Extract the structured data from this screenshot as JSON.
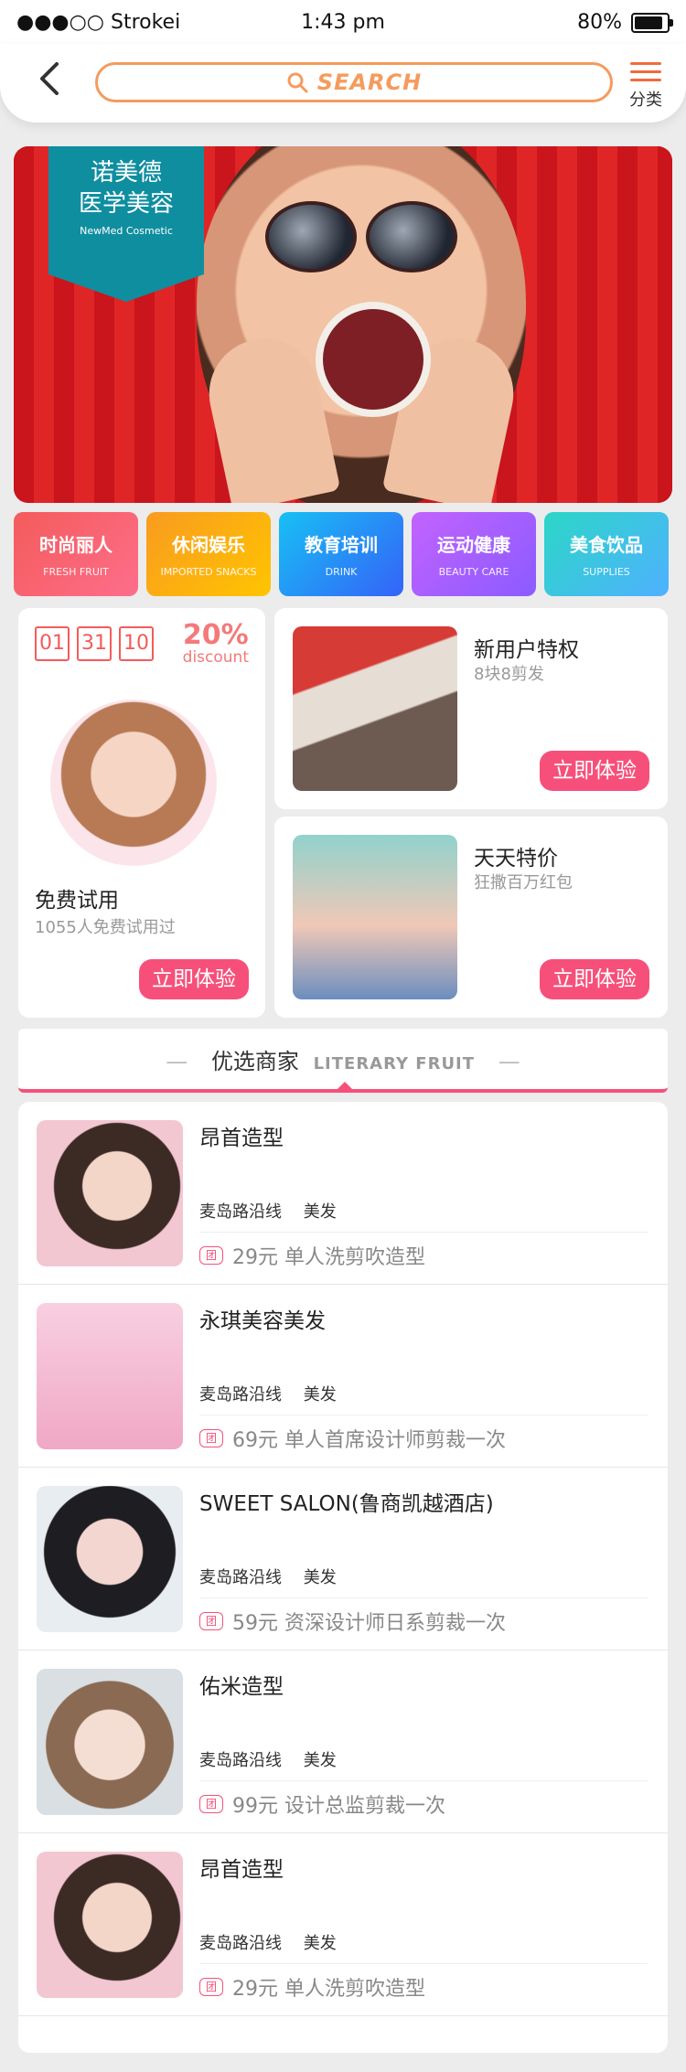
{
  "status": {
    "carrier": "●●●○○ Strokei",
    "time": "1:43 pm",
    "battery": "80%"
  },
  "header": {
    "search_placeholder": "SEARCH",
    "category_label": "分类"
  },
  "banner": {
    "badge_cn": "诺美德\n医学美容",
    "badge_en": "NewMed Cosmetic"
  },
  "categories": [
    {
      "title": "时尚丽人",
      "sub": "FRESH  FRUIT",
      "color_from": "#f45b5b",
      "color_to": "#fd6e8b"
    },
    {
      "title": "休闲娱乐",
      "sub": "IMPORTED SNACKS",
      "color_from": "#f99b20",
      "color_to": "#ffc400"
    },
    {
      "title": "教育培训",
      "sub": "DRINK",
      "color_from": "#17c0f4",
      "color_to": "#3562f8"
    },
    {
      "title": "运动健康",
      "sub": "BEAUTY CARE",
      "color_from": "#c263ff",
      "color_to": "#8b5bff"
    },
    {
      "title": "美食饮品",
      "sub": "SUPPLIES",
      "color_from": "#2cd6c7",
      "color_to": "#4fb1ff"
    }
  ],
  "trial": {
    "countdown": [
      "01",
      "31",
      "10"
    ],
    "discount_pct": "20%",
    "discount_word": "discount",
    "title": "免费试用",
    "subtitle": "1055人免费试用过",
    "button": "立即体验"
  },
  "promos": [
    {
      "title": "新用户特权",
      "subtitle": "8块8剪发",
      "button": "立即体验"
    },
    {
      "title": "天天特价",
      "subtitle": "狂撒百万红包",
      "button": "立即体验"
    }
  ],
  "section": {
    "title": "优选商家",
    "title_en": "LITERARY FRUIT"
  },
  "merchants": [
    {
      "name": "昂首造型",
      "tags": [
        "麦岛路沿线",
        "美发"
      ],
      "offer": "29元  单人洗剪吹造型"
    },
    {
      "name": "永琪美容美发",
      "tags": [
        "麦岛路沿线",
        "美发"
      ],
      "offer": "69元  单人首席设计师剪裁一次"
    },
    {
      "name": "SWEET SALON(鲁商凯越酒店)",
      "tags": [
        "麦岛路沿线",
        "美发"
      ],
      "offer": "59元  资深设计师日系剪裁一次"
    },
    {
      "name": "佑米造型",
      "tags": [
        "麦岛路沿线",
        "美发"
      ],
      "offer": "99元  设计总监剪裁一次"
    },
    {
      "name": "昂首造型",
      "tags": [
        "麦岛路沿线",
        "美发"
      ],
      "offer": "29元  单人洗剪吹造型"
    }
  ],
  "tuan_label": "团"
}
